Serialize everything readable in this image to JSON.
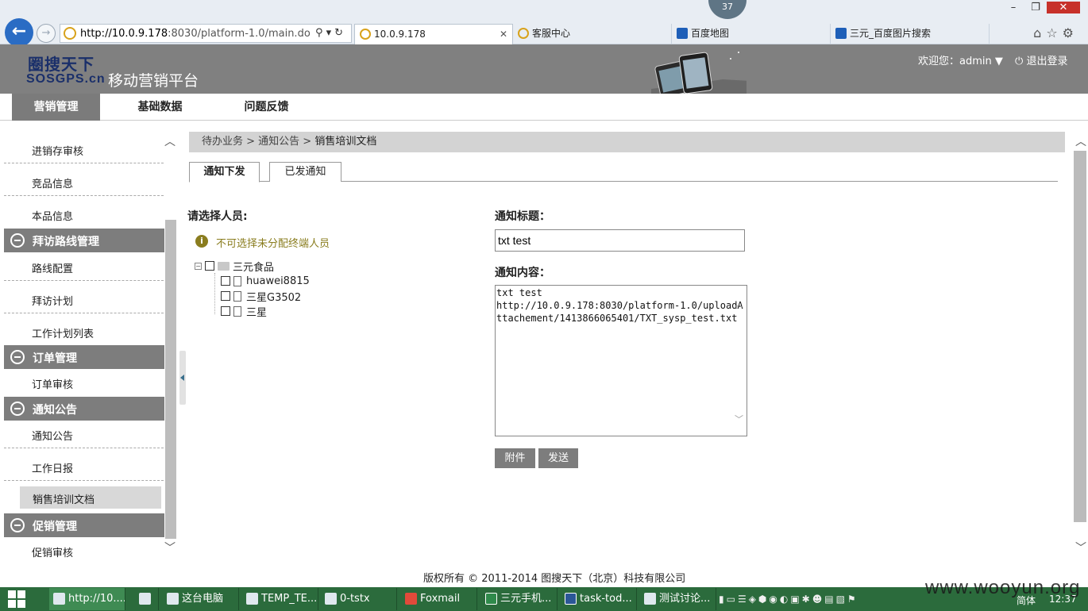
{
  "browser": {
    "counter": "37",
    "address": {
      "host": "http://10.0.9.178",
      "path": ":8030/platform-1.0/main.do"
    },
    "tabs": [
      {
        "label": "10.0.9.178",
        "active": true
      },
      {
        "label": "客服中心"
      },
      {
        "label": "百度地图"
      },
      {
        "label": "三元_百度图片搜索"
      }
    ]
  },
  "header": {
    "logo_text": "圈搜天下",
    "logo_sub": "SOSGPS.cn",
    "app_name": "移动营销平台",
    "welcome": "欢迎您：admin ▼",
    "logout": "退出登录"
  },
  "nav": {
    "items": [
      {
        "label": "营销管理",
        "active": true
      },
      {
        "label": "基础数据"
      },
      {
        "label": "问题反馈"
      }
    ]
  },
  "sidebar": {
    "links_top": [
      "进销存审核",
      "竞品信息",
      "本品信息"
    ],
    "group_visit": "拜访路线管理",
    "visit_links": [
      "路线配置",
      "拜访计划",
      "工作计划列表"
    ],
    "group_order": "订单管理",
    "order_links": [
      "订单审核"
    ],
    "group_notice": "通知公告",
    "notice_links": [
      "通知公告",
      "工作日报"
    ],
    "active_link": "销售培训文档",
    "group_promo": "促销管理",
    "promo_links": [
      "促销审核"
    ]
  },
  "breadcrumb": {
    "part1": "待办业务 > 通知公告 > ",
    "current": "销售培训文档"
  },
  "content_tabs": {
    "send": "通知下发",
    "sent": "已发通知"
  },
  "form": {
    "choose_label": "请选择人员:",
    "info": "不可选择未分配终端人员",
    "tree_root": "三元食品",
    "tree_children": [
      "huawei8815",
      "三星G3502",
      "三星"
    ],
    "title_label": "通知标题：",
    "title_value": "txt test",
    "content_label": "通知内容：",
    "content_value": "txt test\nhttp://10.0.9.178:8030/platform-1.0/uploadAttachement/1413866065401/TXT_sysp_test.txt",
    "attach_button": "附件",
    "send_button": "发送"
  },
  "footer": "版权所有 © 2011-2014 图搜天下（北京）科技有限公司",
  "taskbar": {
    "items": [
      "http://10....",
      "这台电脑",
      "TEMP_TE...",
      "0-tstx",
      "Foxmail",
      "三元手机...",
      "task-tod...",
      "测试讨论..."
    ],
    "ime": "简体",
    "clock": "12:37"
  },
  "watermark": "www.wooyun.org"
}
